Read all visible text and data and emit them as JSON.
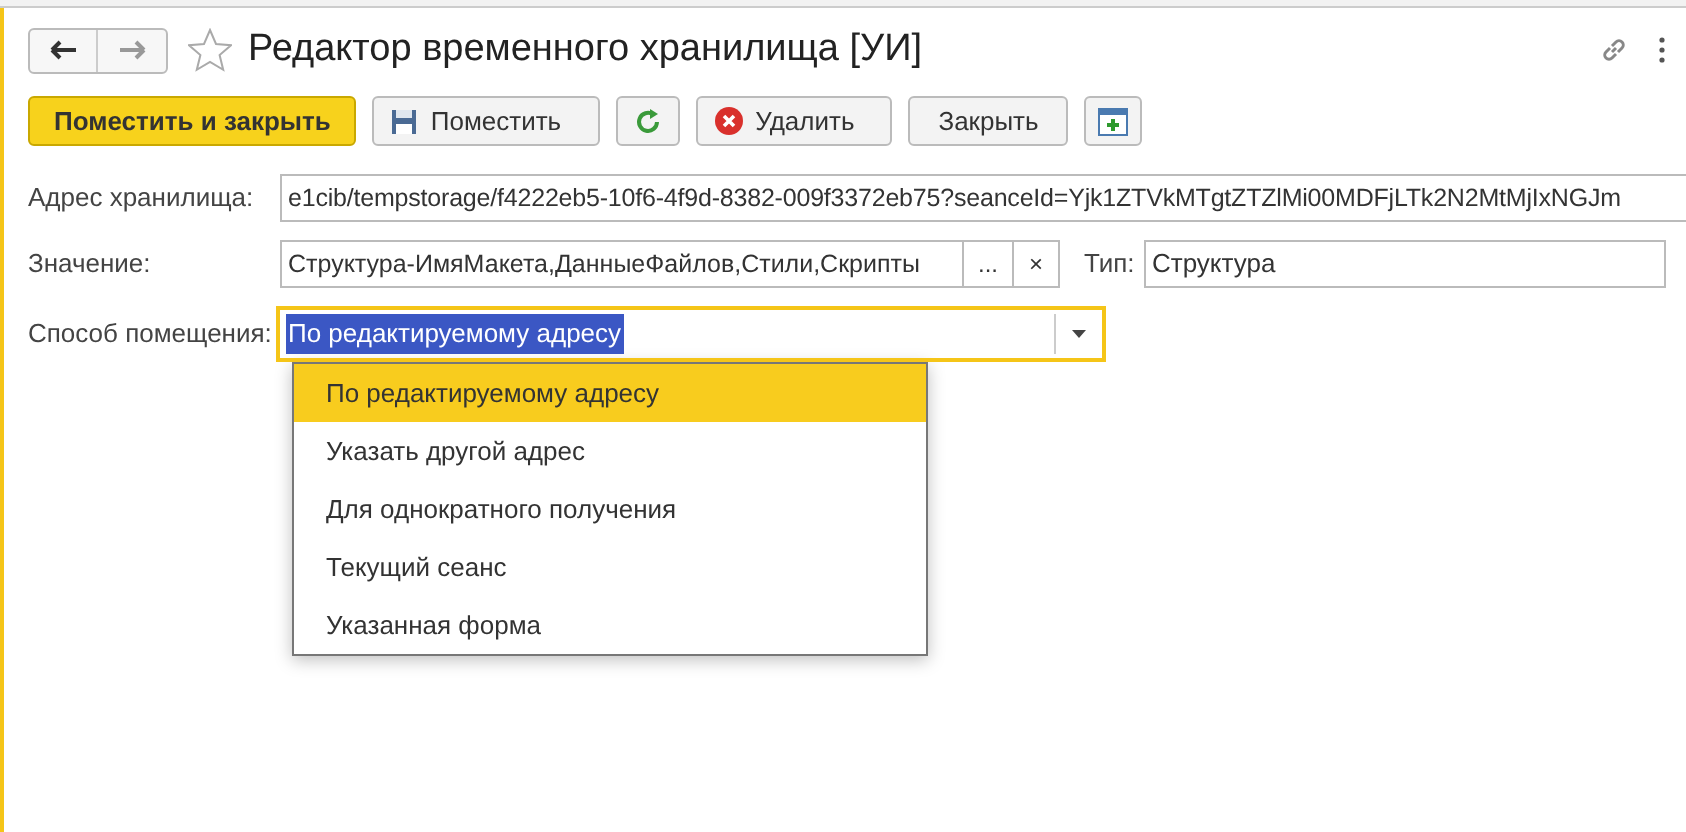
{
  "window": {
    "title": "Редактор временного хранилища [УИ]"
  },
  "toolbar": [
    {
      "kind": "primary",
      "label": "Поместить и закрыть"
    },
    {
      "kind": "save",
      "label": "Поместить"
    },
    {
      "kind": "refresh"
    },
    {
      "kind": "delete",
      "label": "Удалить"
    },
    {
      "kind": "plain",
      "label": "Закрыть"
    },
    {
      "kind": "add"
    }
  ],
  "address": {
    "label": "Адрес хранилища:",
    "value": "e1cib/tempstorage/f4222eb5-10f6-4f9d-8382-009f3372eb75?seanceId=Yjk1ZTVkMTgtZTZlMi00MDFjLTk2N2MtMjIxNGJm"
  },
  "value": {
    "label": "Значение:",
    "value": "Структура-ИмяМакета,ДанныеФайлов,Стили,Скрипты",
    "select_button": "...",
    "clear_button": "×"
  },
  "type": {
    "label": "Тип:",
    "value": "Структура"
  },
  "method": {
    "label": "Способ помещения:",
    "value": "По редактируемому адресу",
    "expanded": true,
    "options": [
      {
        "label": "По редактируемому адресу",
        "selected": true
      },
      {
        "label": "Указать другой адрес",
        "selected": false
      },
      {
        "label": "Для однократного получения",
        "selected": false
      },
      {
        "label": "Текущий сеанс",
        "selected": false
      },
      {
        "label": "Указанная форма",
        "selected": false
      }
    ]
  }
}
